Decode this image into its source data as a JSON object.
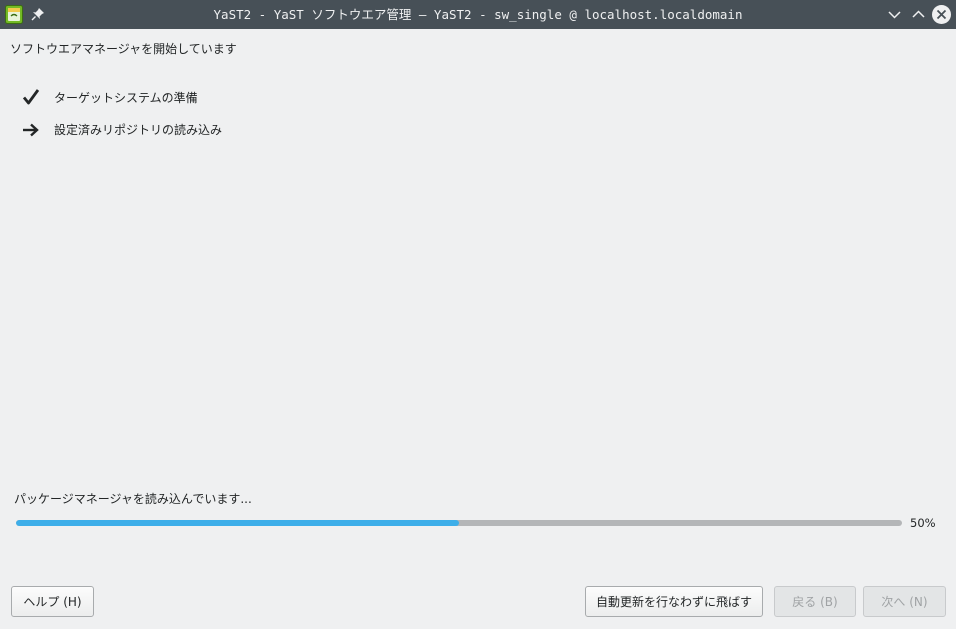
{
  "window": {
    "title": "YaST2 - YaST ソフトウエア管理 — YaST2 - sw_single @ localhost.localdomain",
    "controls": {
      "minimize_icon": "chevron-down-icon",
      "maximize_icon": "chevron-up-icon",
      "close_icon": "close-circle-icon"
    }
  },
  "main": {
    "heading": "ソフトウエアマネージャを開始しています",
    "steps": [
      {
        "label": "ターゲットシステムの準備",
        "status": "done",
        "icon": "checkmark-icon"
      },
      {
        "label": "設定済みリポジトリの読み込み",
        "status": "current",
        "icon": "arrow-right-icon"
      }
    ],
    "progress": {
      "label": "パッケージマネージャを読み込んでいます...",
      "value": 0.5,
      "percent_text": "50%"
    }
  },
  "buttons": {
    "help": "ヘルプ (H)",
    "skip_autorefresh": "自動更新を行なわずに飛ばす",
    "back": "戻る (B)",
    "next": "次へ (N)"
  },
  "colors": {
    "titlebar": "#475057",
    "background": "#eff0f1",
    "progress_fill": "#3daee9",
    "progress_track": "#b4b6b8"
  }
}
